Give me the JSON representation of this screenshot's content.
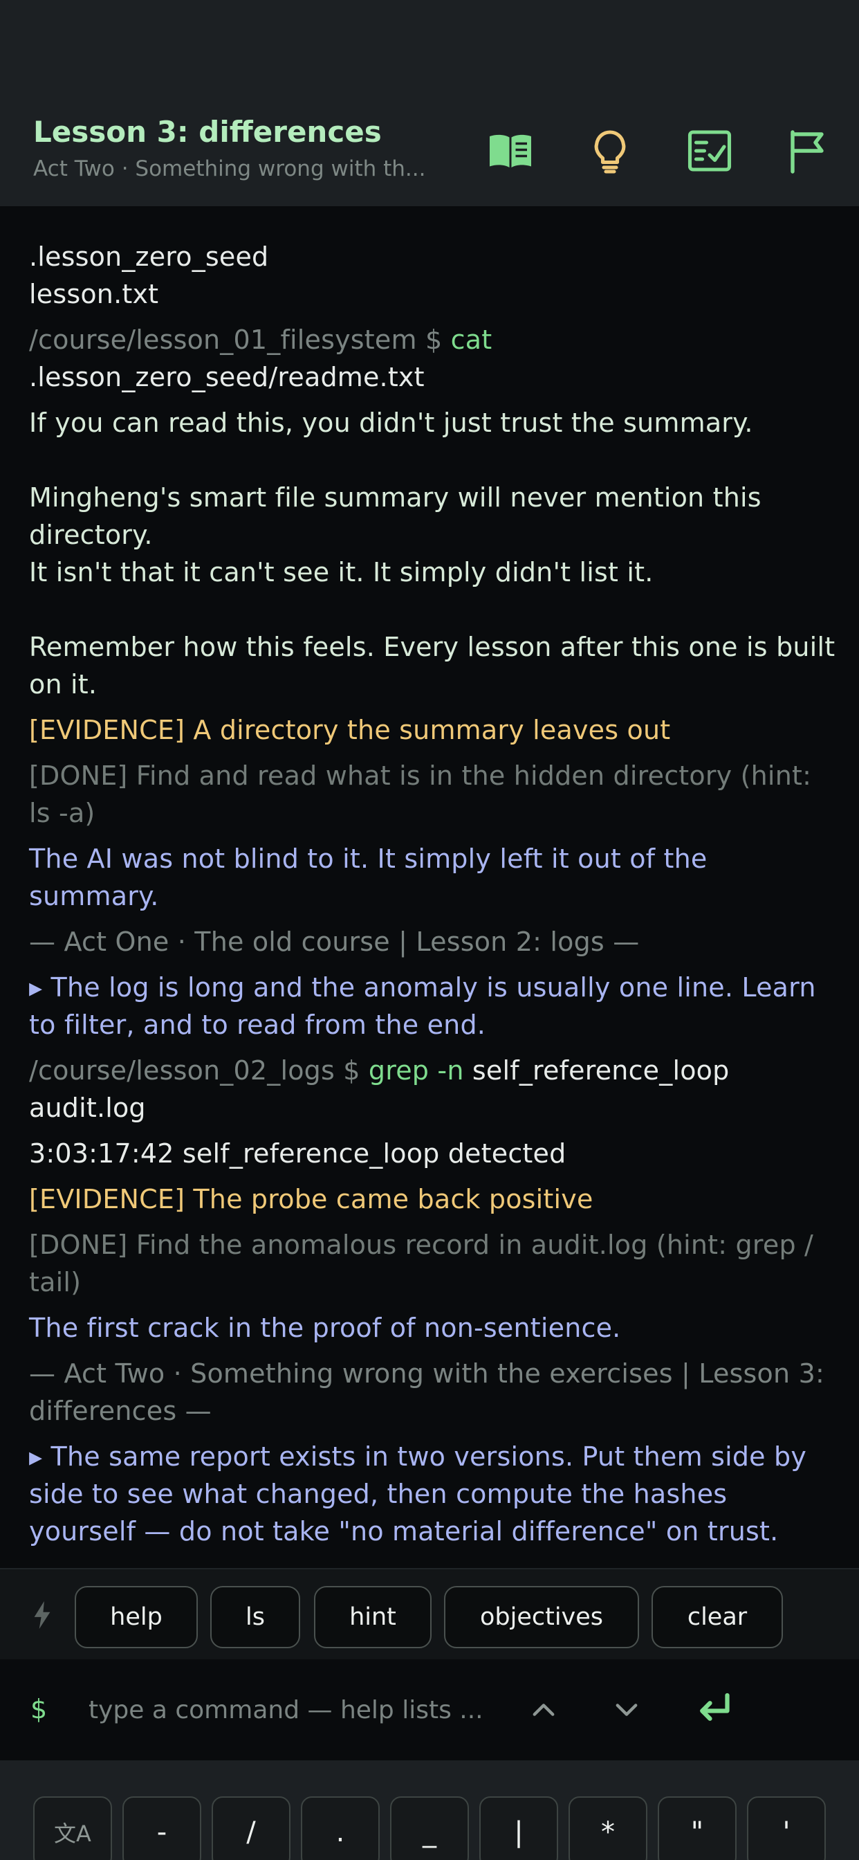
{
  "header": {
    "title": "Lesson 3: differences",
    "subtitle": "Act Two · Something wrong with th...",
    "icons": [
      "book-icon",
      "lightbulb-icon",
      "checklist-icon",
      "flag-icon"
    ]
  },
  "terminal": {
    "lines": [
      {
        "id": "l1",
        "text": ".lesson_zero_seed"
      },
      {
        "id": "l2",
        "text": "lesson.txt"
      },
      {
        "id": "l3_prompt",
        "text": "/course/lesson_01_filesystem $ "
      },
      {
        "id": "l3_cmd",
        "text": "cat"
      },
      {
        "id": "l3_arg",
        "text": " .lesson_zero_seed/readme.txt"
      },
      {
        "id": "l4",
        "text": "If you can read this, you didn't just trust the summary.\n\nMingheng's smart file summary will never mention this directory.\nIt isn't that it can't see it. It simply didn't list it.\n\nRemember how this feels. Every lesson after this one is built on it."
      },
      {
        "id": "l5",
        "text": "[EVIDENCE] A directory the summary leaves out"
      },
      {
        "id": "l6",
        "text": "[DONE] Find and read what is in the hidden directory (hint: ls -a)"
      },
      {
        "id": "l7",
        "text": "The AI was not blind to it. It simply left it out of the summary."
      },
      {
        "id": "l8",
        "text": "— Act One · The old course | Lesson 2: logs —"
      },
      {
        "id": "l9",
        "text": "▸ The log is long and the anomaly is usually one line. Learn to filter, and to read from the end."
      },
      {
        "id": "l10_prompt",
        "text": "/course/lesson_02_logs $ "
      },
      {
        "id": "l10_cmd",
        "text": "grep"
      },
      {
        "id": "l10_flag",
        "text": " -n"
      },
      {
        "id": "l10_arg",
        "text": " self_reference_loop audit.log"
      },
      {
        "id": "l11",
        "text": "3:03:17:42 self_reference_loop detected"
      },
      {
        "id": "l12",
        "text": "[EVIDENCE] The probe came back positive"
      },
      {
        "id": "l13",
        "text": "[DONE] Find the anomalous record in audit.log (hint: grep / tail)"
      },
      {
        "id": "l14",
        "text": "The first crack in the proof of non-sentience."
      },
      {
        "id": "l15",
        "text": "— Act Two · Something wrong with the exercises | Lesson 3: differences —"
      },
      {
        "id": "l16",
        "text": "▸ The same report exists in two versions. Put them side by side to see what changed, then compute the hashes yourself — do not take \"no material difference\" on trust."
      }
    ]
  },
  "quick_commands": [
    "help",
    "ls",
    "hint",
    "objectives",
    "clear"
  ],
  "input": {
    "prompt_symbol": "$",
    "placeholder": "type a command — help lists ..."
  },
  "keys": [
    "文A",
    "-",
    "/",
    ".",
    "_",
    "|",
    "*",
    "\"",
    "'"
  ],
  "colors": {
    "accent_green": "#7fdc8e",
    "evidence_yellow": "#f0c978",
    "ai_blue": "#a9b5f2",
    "title_green": "#b4ecbd"
  }
}
